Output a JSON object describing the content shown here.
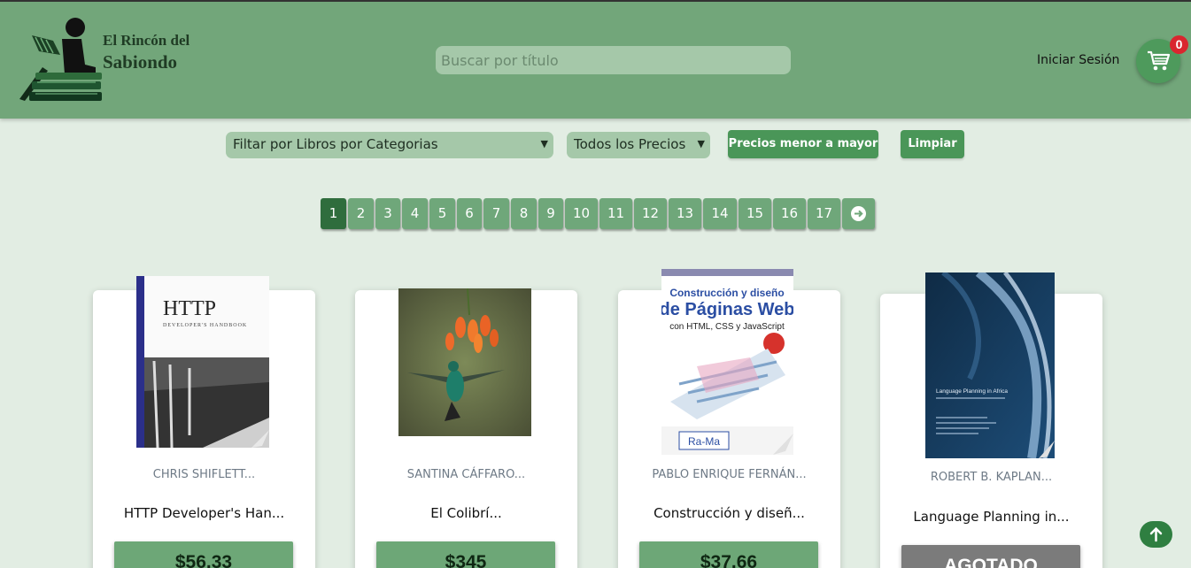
{
  "header": {
    "logo_line1": "El Rincón del",
    "logo_line2": "Sabiondo",
    "search_placeholder": "Buscar por título",
    "login_label": "Iniciar Sesión",
    "cart_count": "0"
  },
  "filters": {
    "category_select": "Filtar por Libros por Categorias",
    "price_select": "Todos los Precios",
    "sort_button": "Precios menor a mayor",
    "clear_button": "Limpiar"
  },
  "pagination": {
    "pages": [
      "1",
      "2",
      "3",
      "4",
      "5",
      "6",
      "7",
      "8",
      "9",
      "10",
      "11",
      "12",
      "13",
      "14",
      "15",
      "16",
      "17"
    ],
    "active": "1"
  },
  "books": [
    {
      "author": "CHRIS SHIFLETT...",
      "title": "HTTP Developer's Han...",
      "price": "$56.33",
      "cover_title": "HTTP",
      "cover_sub": "DEVELOPER'S HANDBOOK"
    },
    {
      "author": "SANTINA CÁFFARO...",
      "title": "El Colibrí...",
      "price": "$345"
    },
    {
      "author": "PABLO ENRIQUE FERNÁN...",
      "title": "Construcción y diseñ...",
      "price": "$37.66",
      "cover_line1": "Construcción y diseño",
      "cover_line2": "de Páginas Web",
      "cover_line3": "con HTML, CSS y JavaScript",
      "cover_publisher": "Ra-Ma"
    },
    {
      "author": "ROBERT B. KAPLAN...",
      "title": "Language Planning in...",
      "price": "AGOTADO",
      "cover_title": "Language Planning in Africa"
    }
  ],
  "colors": {
    "header_bg": "#72a67a",
    "page_bg": "#e2ede3",
    "accent": "#4a9658",
    "badge": "#d9262f"
  }
}
